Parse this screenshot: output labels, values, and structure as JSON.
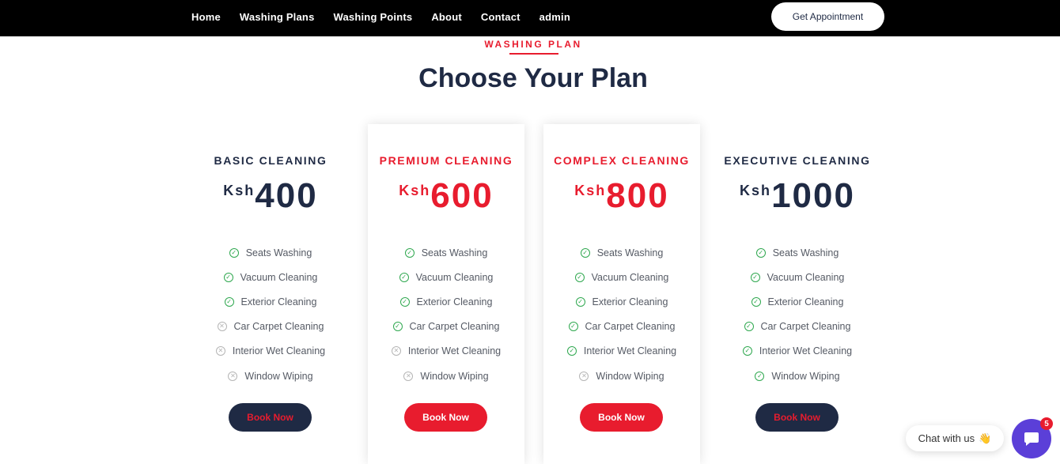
{
  "nav": {
    "items": [
      "Home",
      "Washing Plans",
      "Washing Points",
      "About",
      "Contact",
      "admin"
    ],
    "cta_label": "Get Appointment"
  },
  "section": {
    "eyebrow": "WASHING PLAN",
    "title": "Choose Your Plan"
  },
  "plans": [
    {
      "name": "BASIC CLEANING",
      "currency": "Ksh",
      "price": "400",
      "features": [
        {
          "label": "Seats Washing",
          "included": true
        },
        {
          "label": "Vacuum Cleaning",
          "included": true
        },
        {
          "label": "Exterior Cleaning",
          "included": true
        },
        {
          "label": "Car Carpet Cleaning",
          "included": false
        },
        {
          "label": "Interior Wet Cleaning",
          "included": false
        },
        {
          "label": "Window Wiping",
          "included": false
        }
      ],
      "button": "Book Now"
    },
    {
      "name": "PREMIUM CLEANING",
      "currency": "Ksh",
      "price": "600",
      "features": [
        {
          "label": "Seats Washing",
          "included": true
        },
        {
          "label": "Vacuum Cleaning",
          "included": true
        },
        {
          "label": "Exterior Cleaning",
          "included": true
        },
        {
          "label": "Car Carpet Cleaning",
          "included": true
        },
        {
          "label": "Interior Wet Cleaning",
          "included": false
        },
        {
          "label": "Window Wiping",
          "included": false
        }
      ],
      "button": "Book Now"
    },
    {
      "name": "COMPLEX CLEANING",
      "currency": "Ksh",
      "price": "800",
      "features": [
        {
          "label": "Seats Washing",
          "included": true
        },
        {
          "label": "Vacuum Cleaning",
          "included": true
        },
        {
          "label": "Exterior Cleaning",
          "included": true
        },
        {
          "label": "Car Carpet Cleaning",
          "included": true
        },
        {
          "label": "Interior Wet Cleaning",
          "included": true
        },
        {
          "label": "Window Wiping",
          "included": false
        }
      ],
      "button": "Book Now"
    },
    {
      "name": "EXECUTIVE CLEANING",
      "currency": "Ksh",
      "price": "1000",
      "features": [
        {
          "label": "Seats Washing",
          "included": true
        },
        {
          "label": "Vacuum Cleaning",
          "included": true
        },
        {
          "label": "Exterior Cleaning",
          "included": true
        },
        {
          "label": "Car Carpet Cleaning",
          "included": true
        },
        {
          "label": "Interior Wet Cleaning",
          "included": true
        },
        {
          "label": "Window Wiping",
          "included": true
        }
      ],
      "button": "Book Now"
    }
  ],
  "chat": {
    "label": "Chat with us",
    "wave_icon": "👋",
    "badge_count": "5"
  },
  "colors": {
    "accent": "#e81c2e",
    "navy": "#1f2a44",
    "included": "#2fa84f",
    "excluded": "#b5b5b5",
    "chat_launcher": "#5b3fd8"
  }
}
